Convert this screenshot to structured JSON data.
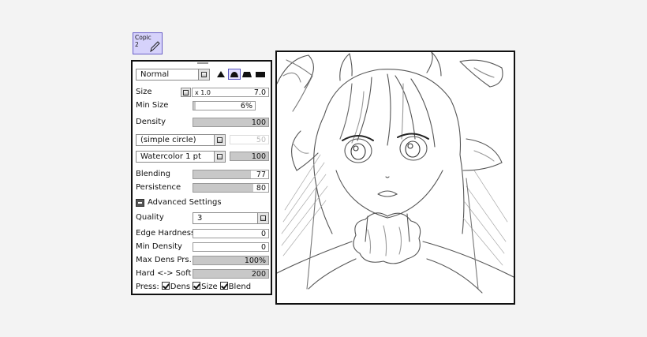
{
  "tool": {
    "name": "Copic",
    "number": "2",
    "icon": "pen-icon"
  },
  "brush": {
    "blend_mode": "Normal",
    "shapes": [
      "shape-hard",
      "shape-medium",
      "shape-soft",
      "shape-flat"
    ],
    "size": {
      "label": "Size",
      "multiplier": "x 1.0",
      "value": "7.0"
    },
    "min_size": {
      "label": "Min Size",
      "value": "6%",
      "fraction": 0.06
    },
    "density": {
      "label": "Density",
      "value": "100",
      "fraction": 1.0
    },
    "texture": {
      "value": "(simple circle)",
      "strength": "50"
    },
    "paper": {
      "value": "Watercolor 1 pt",
      "strength": "100",
      "fraction": 1.0
    },
    "blending": {
      "label": "Blending",
      "value": "77",
      "fraction": 0.77
    },
    "persistence": {
      "label": "Persistence",
      "value": "80",
      "fraction": 0.8
    },
    "advanced": {
      "label": "Advanced Settings"
    },
    "quality": {
      "label": "Quality",
      "value": "3"
    },
    "edge_hardness": {
      "label": "Edge Hardness",
      "value": "0",
      "fraction": 0.0
    },
    "min_density": {
      "label": "Min Density",
      "value": "0",
      "fraction": 0.0
    },
    "max_dens_prs": {
      "label": "Max Dens Prs.",
      "value": "100%",
      "fraction": 1.0
    },
    "hard_soft": {
      "label": "Hard <-> Soft",
      "value": "200",
      "fraction": 1.0
    },
    "press": {
      "label": "Press:",
      "dens": "Dens",
      "size": "Size",
      "blend": "Blend"
    }
  },
  "canvas": {
    "content": "sketch-illustration"
  }
}
